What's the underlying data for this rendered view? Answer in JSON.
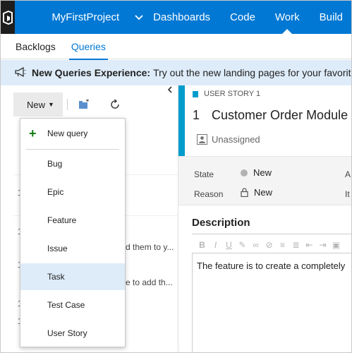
{
  "topbar": {
    "project_name": "MyFirstProject",
    "nav": [
      "Dashboards",
      "Code",
      "Work",
      "Build"
    ],
    "active_nav": "Work"
  },
  "subnav": {
    "items": [
      "Backlogs",
      "Queries"
    ],
    "active": "Queries"
  },
  "banner": {
    "title": "New Queries Experience:",
    "message": "Try out the new landing pages for your favorite,"
  },
  "left": {
    "new_button_label": "New",
    "background_fragments": [
      "d them to y...",
      "e to add th..."
    ]
  },
  "menu": {
    "new_query_label": "New query",
    "items": [
      "Bug",
      "Epic",
      "Feature",
      "Issue",
      "Task",
      "Test Case",
      "User Story"
    ],
    "selected": "Task"
  },
  "work_item": {
    "type_label": "USER STORY 1",
    "id": "1",
    "title": "Customer Order Module",
    "assignee": "Unassigned",
    "fields": {
      "state_label": "State",
      "state_value": "New",
      "reason_label": "Reason",
      "reason_value": "New",
      "col2_label_1": "A",
      "col2_label_2": "It"
    },
    "description_heading": "Description",
    "description_text": "The feature is to create a completely"
  },
  "colors": {
    "brand_blue": "#0078d4",
    "logo_bg": "#1e1e1e",
    "banner_bg": "#deecf9",
    "user_story_accent": "#009ccc",
    "add_green": "#107c10",
    "selected_bg": "#deecf9"
  },
  "icons": {
    "logo": "vsts-logo-icon",
    "project_dropdown": "chevron-down-icon",
    "banner": "megaphone-icon",
    "new_query": "plus-icon",
    "toolbar_1": "new-folder-icon",
    "toolbar_2": "refresh-icon",
    "collapse": "chevron-left-icon",
    "assignee": "person-icon",
    "state": "state-dot-icon",
    "reason": "lock-icon"
  }
}
